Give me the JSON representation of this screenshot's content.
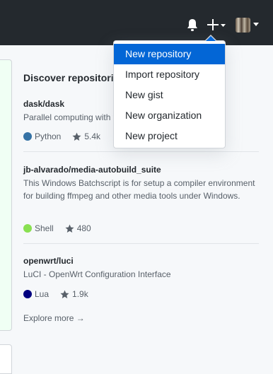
{
  "header": {
    "icons": [
      "bell-icon",
      "plus-icon",
      "caret-down-icon",
      "avatar"
    ]
  },
  "discover": {
    "title": "Discover repositories",
    "repos": [
      {
        "name": "dask/dask",
        "description": "Parallel computing with task scheduling",
        "language": "Python",
        "language_color": "#3572A5",
        "stars": "5.4k"
      },
      {
        "name": "jb-alvarado/media-autobuild_suite",
        "description": "This Windows Batchscript is for setup a compiler environment for building ffmpeg and other media tools under Windows.",
        "language": "Shell",
        "language_color": "#89e051",
        "stars": "480"
      },
      {
        "name": "openwrt/luci",
        "description": "LuCI - OpenWrt Configuration Interface",
        "language": "Lua",
        "language_color": "#000080",
        "stars": "1.9k"
      }
    ],
    "explore_more": "Explore more →"
  },
  "create_menu": {
    "items": [
      {
        "label": "New repository",
        "selected": true
      },
      {
        "label": "Import repository",
        "selected": false
      },
      {
        "label": "New gist",
        "selected": false
      },
      {
        "label": "New organization",
        "selected": false
      },
      {
        "label": "New project",
        "selected": false
      }
    ]
  },
  "colors": {
    "header_bg": "#24292e",
    "accent": "#0366d6"
  }
}
